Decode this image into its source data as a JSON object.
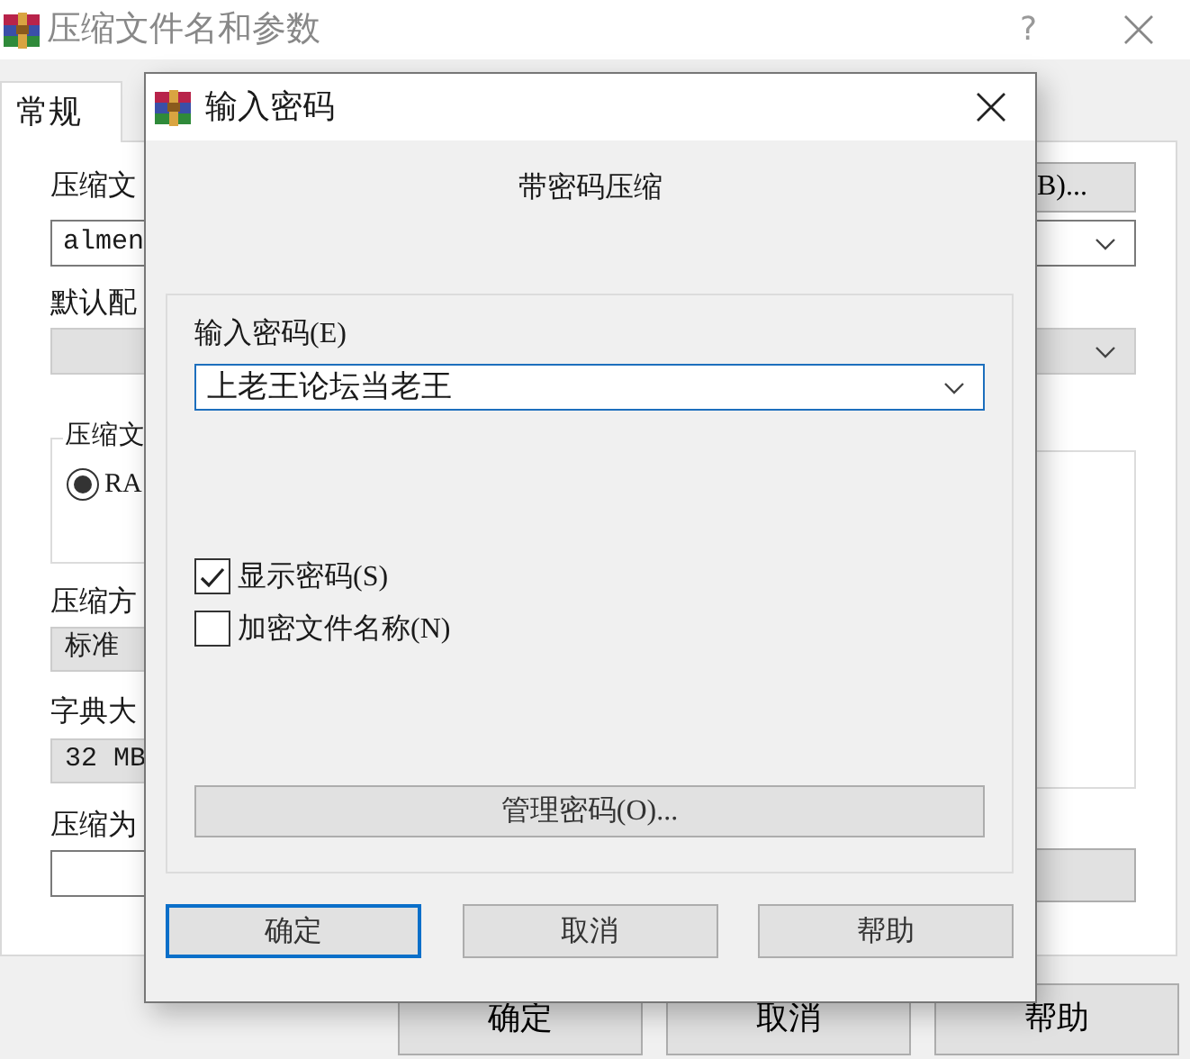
{
  "main_window": {
    "title": "压缩文件名和参数",
    "help_button": "?",
    "tabs": [
      {
        "label": "常规",
        "selected": true
      }
    ],
    "archive_name": {
      "label": "压缩文",
      "value": "almen"
    },
    "browse_button": "B)...",
    "profile_label": "默认配",
    "archive_format": {
      "label": "压缩文",
      "options": [
        {
          "label": "RA",
          "selected": true
        }
      ]
    },
    "method": {
      "label": "压缩方",
      "value": "标准"
    },
    "dictionary": {
      "label": "字典大",
      "value": "32 MB"
    },
    "split": {
      "label": "压缩为"
    },
    "buttons": [
      "确定",
      "取消",
      "帮助"
    ]
  },
  "password_dialog": {
    "title": "输入密码",
    "heading": "带密码压缩",
    "password": {
      "label": "输入密码(E)",
      "value": "上老王论坛当老王"
    },
    "options": [
      {
        "label": "显示密码(S)",
        "checked": true
      },
      {
        "label": "加密文件名称(N)",
        "checked": false
      }
    ],
    "manage_button": "管理密码(O)...",
    "buttons": [
      {
        "label": "确定",
        "default": true
      },
      {
        "label": "取消",
        "default": false
      },
      {
        "label": "帮助",
        "default": false
      }
    ]
  }
}
